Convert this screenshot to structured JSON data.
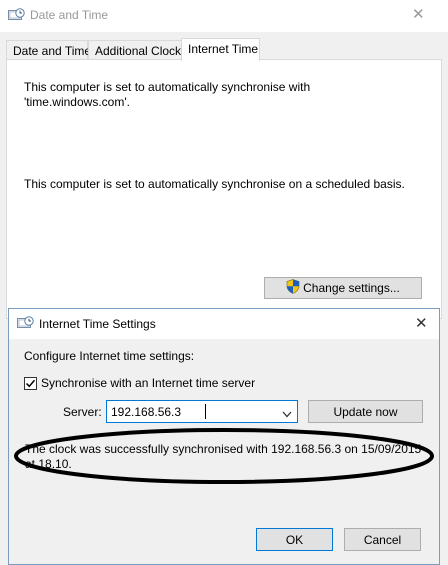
{
  "window": {
    "title": "Date and Time",
    "close_glyph": "✕",
    "tabs": [
      {
        "label": "Date and Time"
      },
      {
        "label": "Additional Clocks"
      },
      {
        "label": "Internet Time"
      }
    ],
    "active_tab": "Internet Time",
    "sync_text": "This computer is set to automatically synchronise with 'time.windows.com'.",
    "schedule_text": "This computer is set to automatically synchronise on a scheduled basis.",
    "change_settings_label": "Change settings...",
    "change_settings_icon": "uac-shield-icon"
  },
  "dialog": {
    "title": "Internet Time Settings",
    "close_glyph": "✕",
    "configure_label": "Configure Internet time settings:",
    "sync_checkbox_label": "Synchronise with an Internet time server",
    "sync_checked": true,
    "server_label": "Server:",
    "server_value": "192.168.56.3",
    "update_now_label": "Update now",
    "status_message": "The clock was successfully synchronised with 192.168.56.3 on 15/09/2015 at 18.10.",
    "ok_label": "OK",
    "cancel_label": "Cancel"
  },
  "colors": {
    "accent": "#0078d7",
    "annotation": "#000000"
  }
}
